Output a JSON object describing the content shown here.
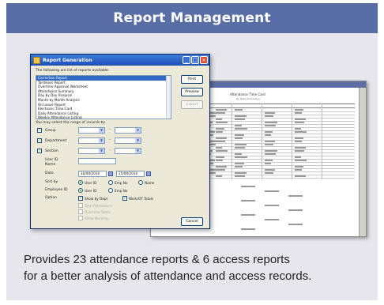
{
  "header": {
    "title": "Report Management"
  },
  "description": {
    "line1": "Provides 23 attendance reports & 6 access reports",
    "line2": "for a better analysis of attendance and access records."
  },
  "dialog": {
    "title": "Report Generation",
    "list_caption": "The following are list of reports available:",
    "reports": [
      "Correction Report",
      "Tardiness Report",
      "Overtime Approval Worksheet",
      "Attendance Summary",
      "Day by Day Analysis",
      "Month by Month Analysis",
      "On Leave Report",
      "Electronic Time Card",
      "Daily Attendance Listing",
      "Weekly Attendance Listing"
    ],
    "selected_index": 0,
    "range_caption": "You may select the range of records by",
    "buttons": {
      "print": "Print",
      "preview": "Preview",
      "export": "Export",
      "cancel": "Cancel"
    },
    "filters": {
      "group": "Group",
      "department": "Department",
      "section": "Section"
    },
    "fields": {
      "user_id": "User ID",
      "name": "Name",
      "date": "Date",
      "date_from": "16/09/2010",
      "date_to": "25/09/2010",
      "sort_by": "Sort by",
      "employee_id": "Employee ID",
      "option": "Option"
    },
    "sort_options": [
      "User ID",
      "Emp No",
      "Name"
    ],
    "employee_options": [
      "User ID",
      "Emp No"
    ],
    "options": {
      "show_by_dept": "Show by Dept",
      "work_ot_totals": "Work/OT Totals",
      "dim1": "Total Attendance",
      "dim2": "Overtime Totals",
      "dim3": "Show Working"
    }
  },
  "preview": {
    "title": "Attendance Time Card",
    "subtitle": "By Date (Summary)"
  }
}
